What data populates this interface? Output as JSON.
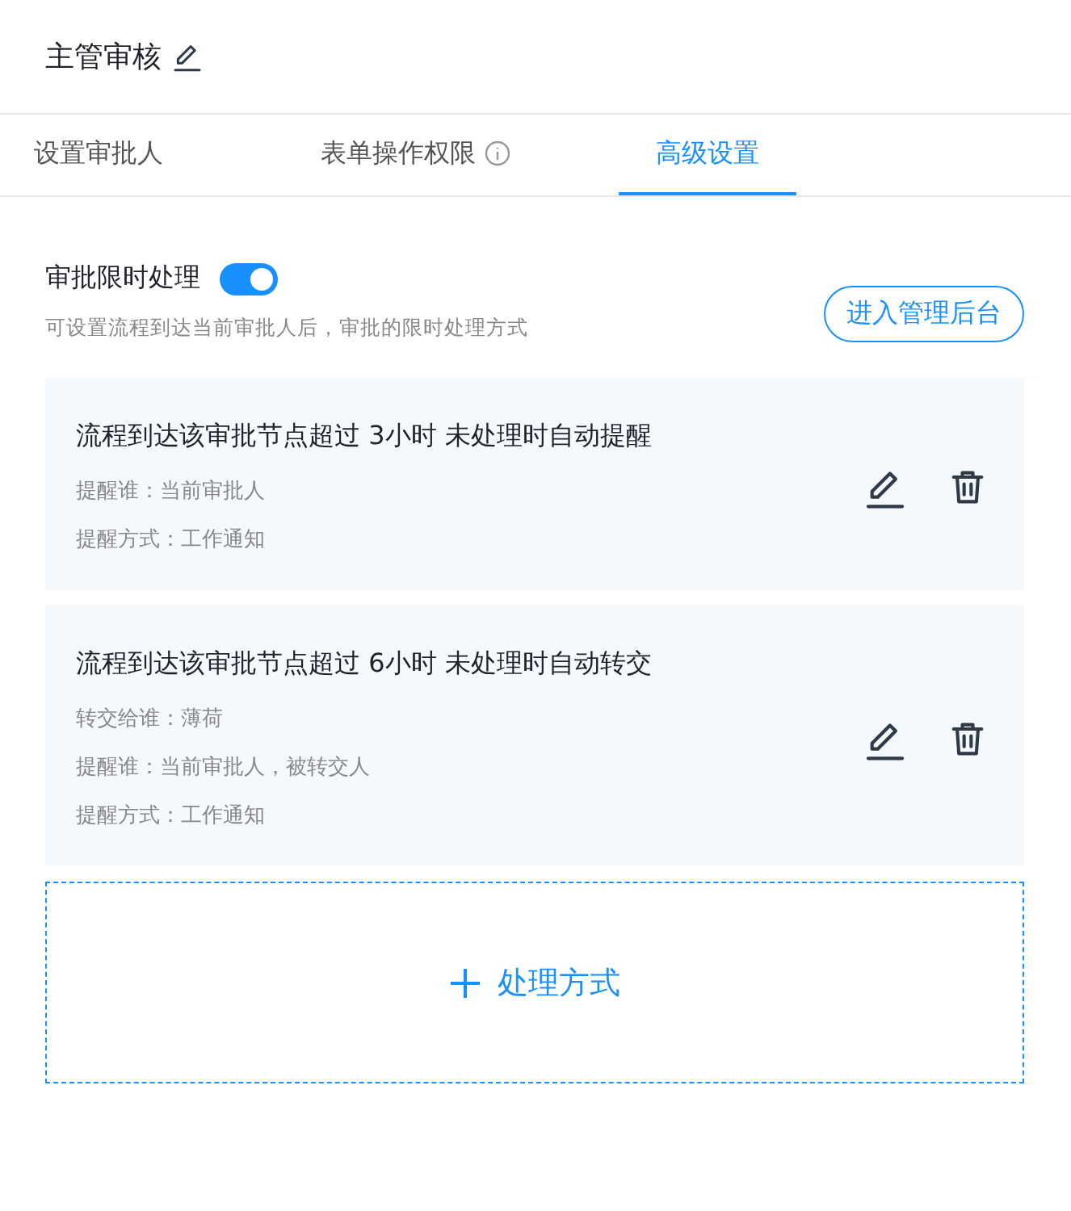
{
  "header": {
    "title": "主管审核"
  },
  "tabs": [
    {
      "label": "设置审批人",
      "selected": false,
      "info": false
    },
    {
      "label": "表单操作权限",
      "selected": false,
      "info": true
    },
    {
      "label": "高级设置",
      "selected": true,
      "info": false
    }
  ],
  "time_limit": {
    "label": "审批限时处理",
    "on": true,
    "description": "可设置流程到达当前审批人后，审批的限时处理方式",
    "admin_button": "进入管理后台"
  },
  "rules": [
    {
      "title": "流程到达该审批节点超过 3小时 未处理时自动提醒",
      "details": [
        "提醒谁：当前审批人",
        "提醒方式：工作通知"
      ]
    },
    {
      "title": "流程到达该审批节点超过 6小时 未处理时自动转交",
      "details": [
        "转交给谁：薄荷",
        "提醒谁：当前审批人，被转交人",
        "提醒方式：工作通知"
      ]
    }
  ],
  "add_button": "处理方式"
}
